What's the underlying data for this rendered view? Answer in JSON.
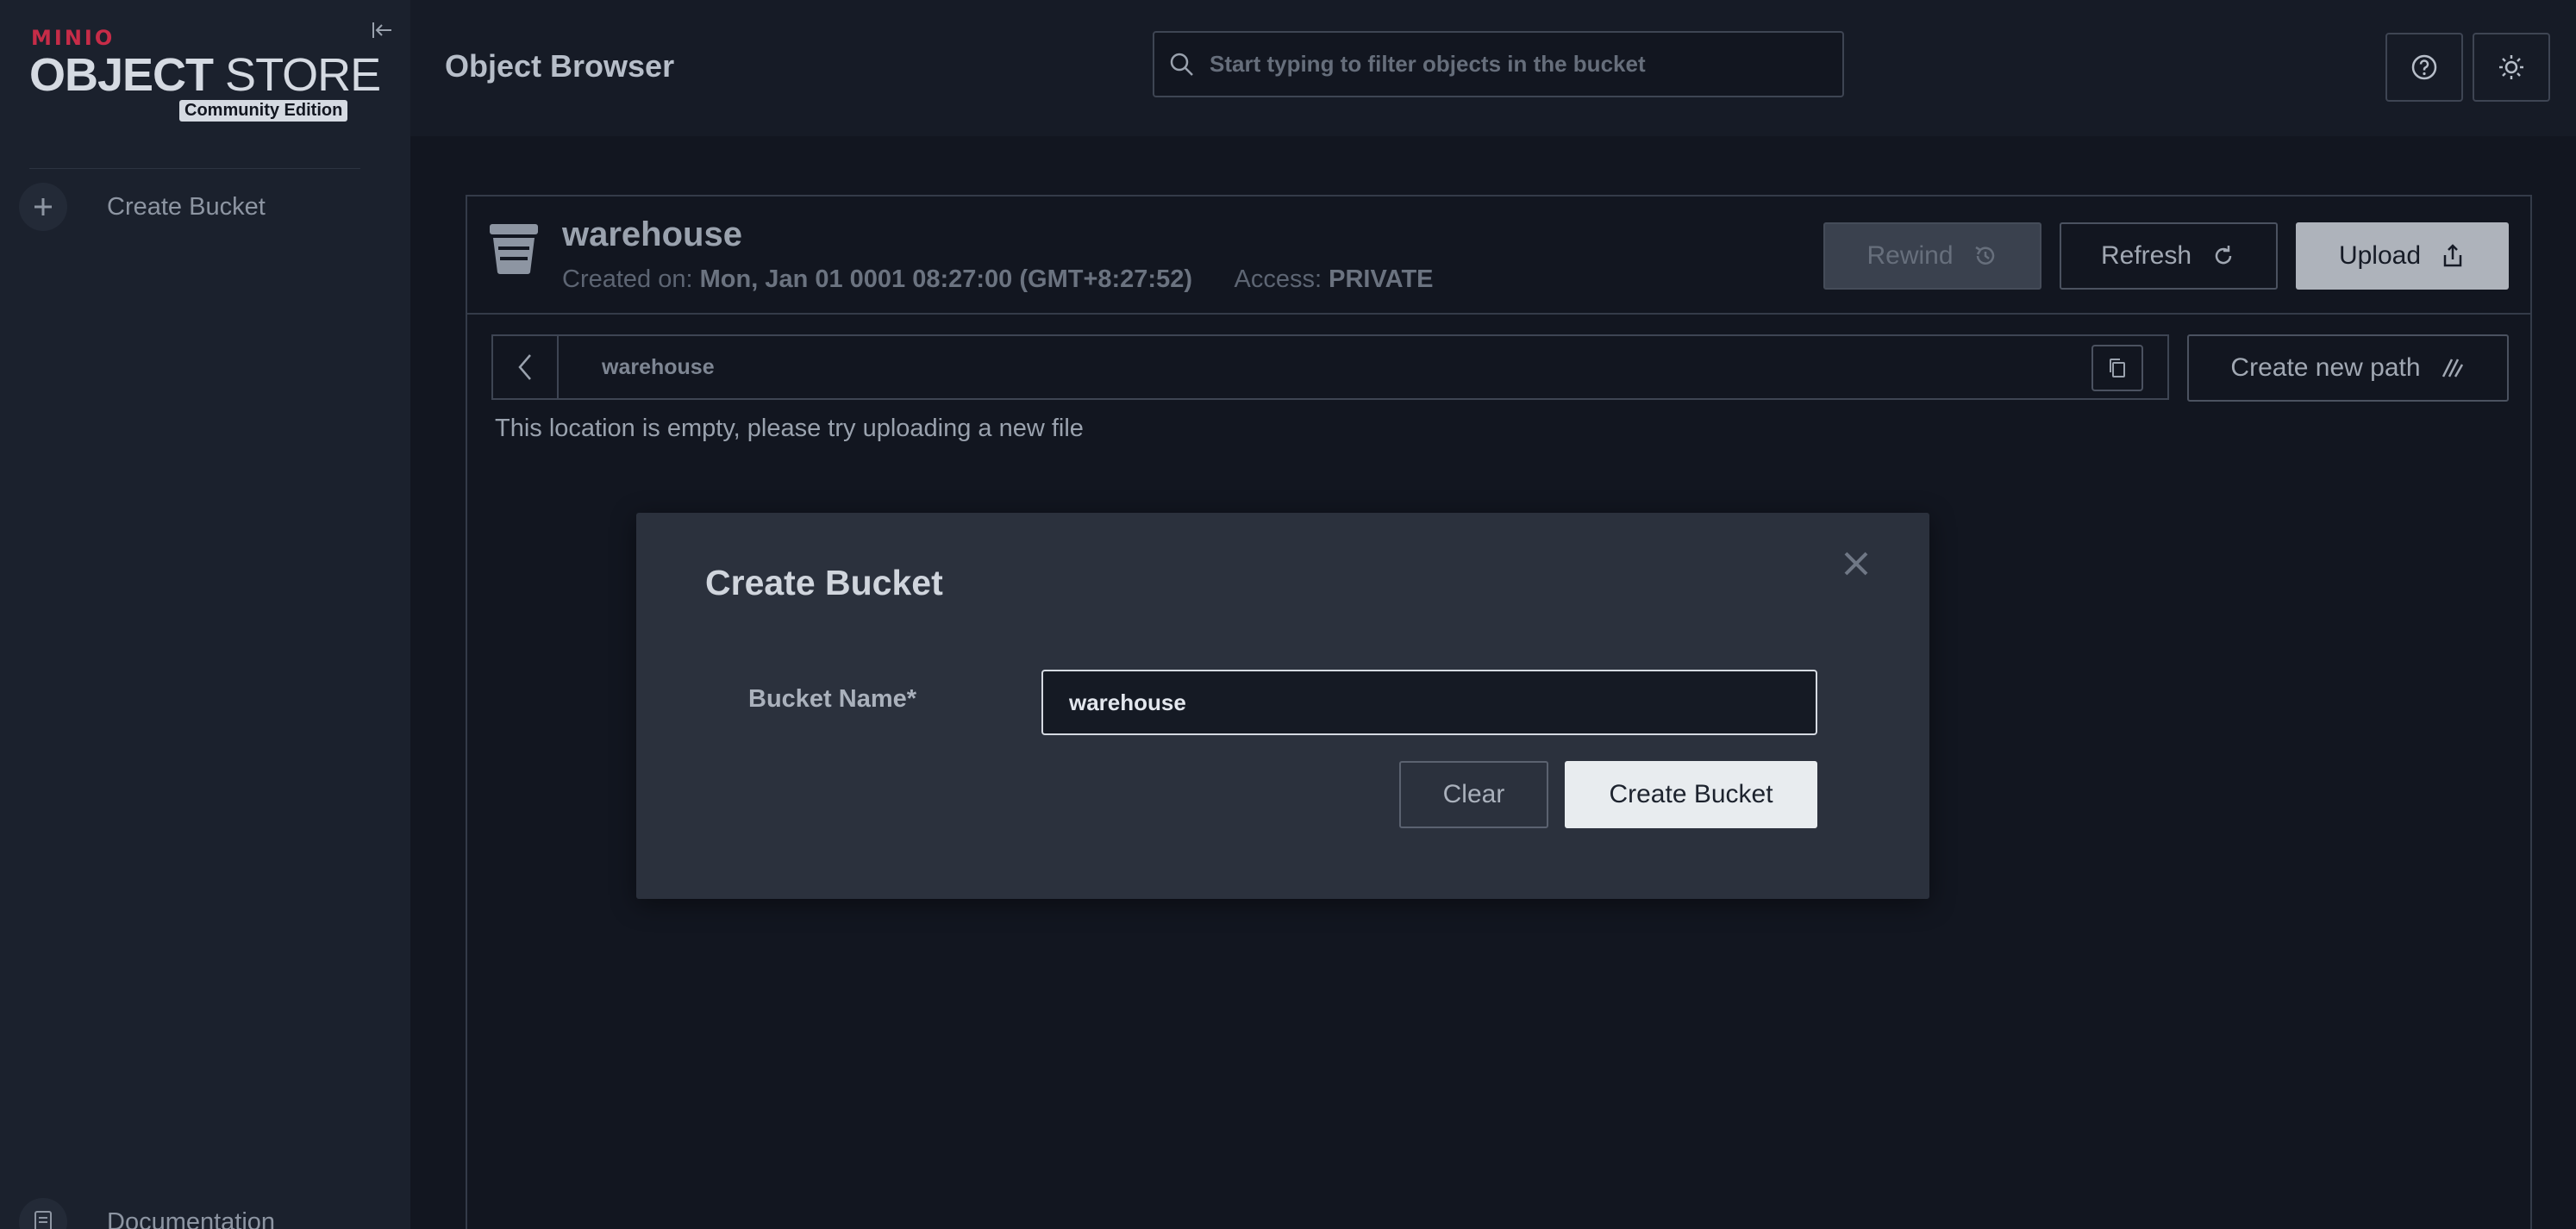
{
  "sidebar": {
    "logo": {
      "brand": "MINIO",
      "product_bold": "OBJECT",
      "product_light": " STORE",
      "edition": "Community Edition"
    },
    "items": [
      {
        "label": "Create Bucket",
        "icon": "plus-icon"
      },
      {
        "label": "Documentation",
        "icon": "document-icon"
      }
    ]
  },
  "header": {
    "title": "Object Browser",
    "search": {
      "placeholder": "Start typing to filter objects in the bucket",
      "value": ""
    }
  },
  "bucket": {
    "name": "warehouse",
    "created_label": "Created on:",
    "created_value": "Mon, Jan 01 0001 08:27:00 (GMT+8:27:52)",
    "access_label": "Access:",
    "access_value": "PRIVATE",
    "buttons": {
      "rewind": "Rewind",
      "refresh": "Refresh",
      "upload": "Upload",
      "new_path": "Create new path"
    },
    "path": "warehouse",
    "empty_message": "This location is empty, please try uploading a new file"
  },
  "modal": {
    "title": "Create Bucket",
    "field_label": "Bucket Name*",
    "field_value": "warehouse",
    "clear_label": "Clear",
    "create_label": "Create Bucket"
  },
  "colors": {
    "background": "#121620",
    "sidebar": "#1b212d",
    "modal": "#2b313d",
    "brand_red": "#c72c48"
  }
}
